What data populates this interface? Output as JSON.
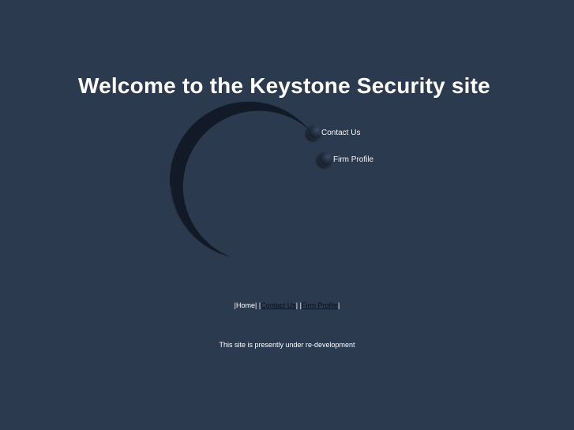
{
  "header": {
    "title": "Welcome to the Keystone Security site"
  },
  "nav": {
    "contact_label": "Contact Us",
    "firm_label": "Firm Profile"
  },
  "footer": {
    "home_label": "Home",
    "contact_label": "Contact Us",
    "firm_label": "Firm Profile",
    "separator_open": "|",
    "separator_close": "|"
  },
  "status": {
    "message": "This site is presently under re-development"
  },
  "colors": {
    "background": "#2c3a4f",
    "text": "#ffffff",
    "link": "#0b0f18"
  },
  "icons": {
    "bubble": "circle-bullet-icon",
    "orbit": "crescent-arc"
  }
}
